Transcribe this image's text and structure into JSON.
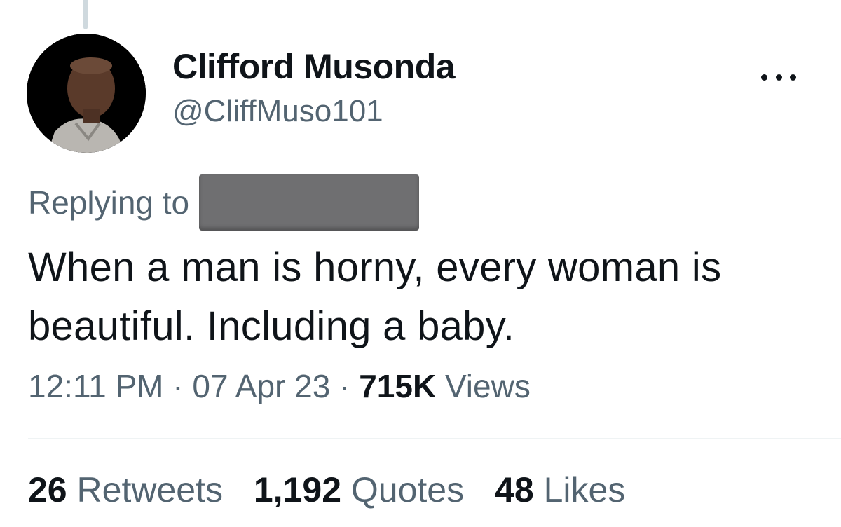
{
  "author": {
    "display_name": "Clifford Musonda",
    "handle": "@CliffMuso101",
    "avatar_icon": "user-photo"
  },
  "reply": {
    "label": "Replying to"
  },
  "tweet": {
    "text": "When a man is horny, every woman is beautiful. Including a baby."
  },
  "meta": {
    "time": "12:11 PM",
    "separator": "·",
    "date": "07 Apr 23",
    "views_count": "715K",
    "views_label": "Views"
  },
  "stats": {
    "retweets": {
      "count": "26",
      "label": "Retweets"
    },
    "quotes": {
      "count": "1,192",
      "label": "Quotes"
    },
    "likes": {
      "count": "48",
      "label": "Likes"
    }
  },
  "colors": {
    "text_primary": "#0f1419",
    "text_secondary": "#536471",
    "redaction": "#6f6f71",
    "divider": "#eff3f4"
  }
}
